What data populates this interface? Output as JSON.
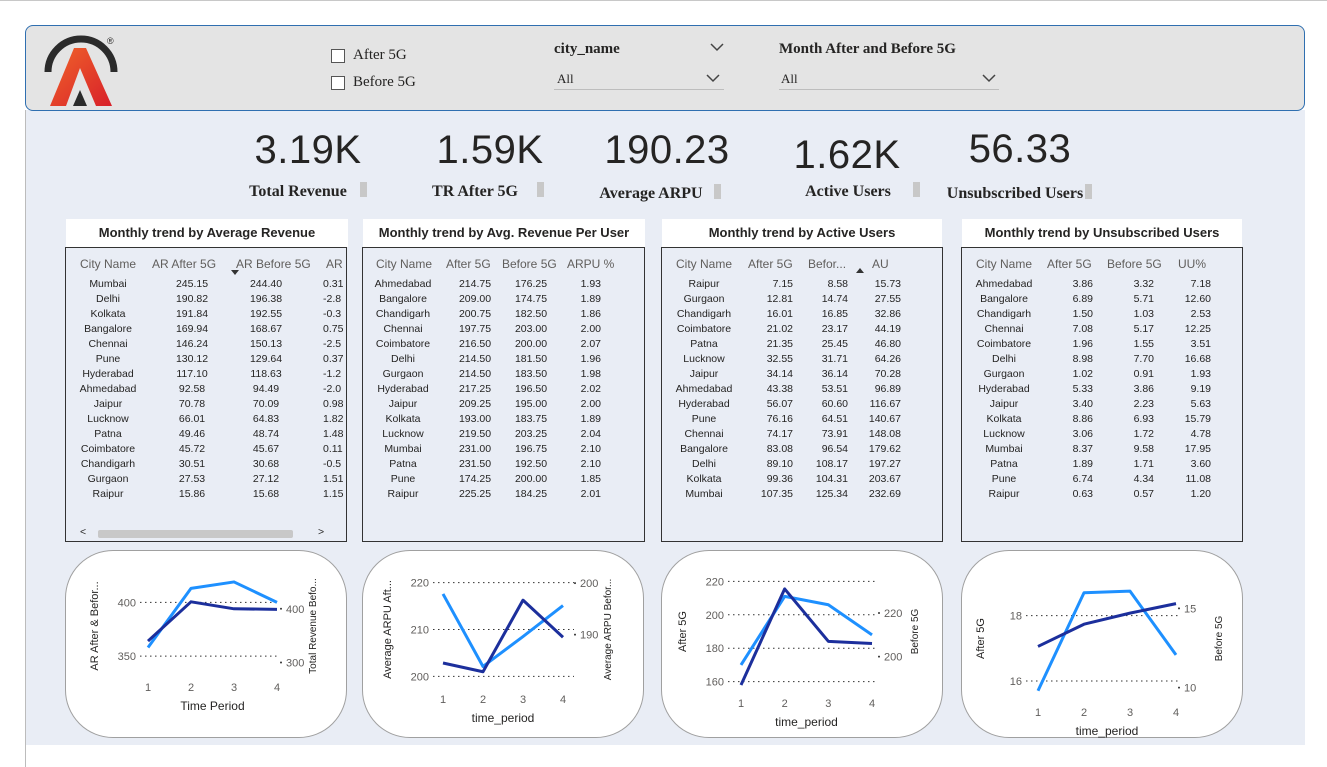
{
  "header": {
    "registered": "®",
    "checkboxes": [
      "After 5G",
      "Before 5G"
    ],
    "slicer_city": {
      "title": "city_name",
      "value": "All"
    },
    "slicer_month": {
      "title": "Month After and Before 5G",
      "value": "All"
    }
  },
  "kpis": [
    {
      "value": "3.19K",
      "label": "Total Revenue"
    },
    {
      "value": "1.59K",
      "label": "TR After 5G"
    },
    {
      "value": "190.23",
      "label": "Average ARPU"
    },
    {
      "value": "1.62K",
      "label": "Active Users"
    },
    {
      "value": "56.33",
      "label": "Unsubscribed Users"
    }
  ],
  "tables": [
    {
      "title": "Monthly trend by Average Revenue",
      "headers": [
        "City Name",
        "AR After 5G",
        "AR Before 5G",
        "AR"
      ],
      "rows": [
        [
          "Mumbai",
          "245.15",
          "244.40",
          "0.31"
        ],
        [
          "Delhi",
          "190.82",
          "196.38",
          "-2.8"
        ],
        [
          "Kolkata",
          "191.84",
          "192.55",
          "-0.3"
        ],
        [
          "Bangalore",
          "169.94",
          "168.67",
          "0.75"
        ],
        [
          "Chennai",
          "146.24",
          "150.13",
          "-2.5"
        ],
        [
          "Pune",
          "130.12",
          "129.64",
          "0.37"
        ],
        [
          "Hyderabad",
          "117.10",
          "118.63",
          "-1.2"
        ],
        [
          "Ahmedabad",
          "92.58",
          "94.49",
          "-2.0"
        ],
        [
          "Jaipur",
          "70.78",
          "70.09",
          "0.98"
        ],
        [
          "Lucknow",
          "66.01",
          "64.83",
          "1.82"
        ],
        [
          "Patna",
          "49.46",
          "48.74",
          "1.48"
        ],
        [
          "Coimbatore",
          "45.72",
          "45.67",
          "0.11"
        ],
        [
          "Chandigarh",
          "30.51",
          "30.68",
          "-0.5"
        ],
        [
          "Gurgaon",
          "27.53",
          "27.12",
          "1.51"
        ],
        [
          "Raipur",
          "15.86",
          "15.68",
          "1.15"
        ]
      ],
      "scroll_left": "<",
      "scroll_right": ">"
    },
    {
      "title": "Monthly trend by Avg. Revenue Per User",
      "headers": [
        "City Name",
        "After 5G",
        "Before 5G",
        "ARPU %"
      ],
      "rows": [
        [
          "Ahmedabad",
          "214.75",
          "176.25",
          "1.93"
        ],
        [
          "Bangalore",
          "209.00",
          "174.75",
          "1.89"
        ],
        [
          "Chandigarh",
          "200.75",
          "182.50",
          "1.86"
        ],
        [
          "Chennai",
          "197.75",
          "203.00",
          "2.00"
        ],
        [
          "Coimbatore",
          "216.50",
          "200.00",
          "2.07"
        ],
        [
          "Delhi",
          "214.50",
          "181.50",
          "1.96"
        ],
        [
          "Gurgaon",
          "214.50",
          "183.50",
          "1.98"
        ],
        [
          "Hyderabad",
          "217.25",
          "196.50",
          "2.02"
        ],
        [
          "Jaipur",
          "209.25",
          "195.00",
          "2.00"
        ],
        [
          "Kolkata",
          "193.00",
          "183.75",
          "1.89"
        ],
        [
          "Lucknow",
          "219.50",
          "203.25",
          "2.04"
        ],
        [
          "Mumbai",
          "231.00",
          "196.75",
          "2.10"
        ],
        [
          "Patna",
          "231.50",
          "192.50",
          "2.10"
        ],
        [
          "Pune",
          "174.25",
          "200.00",
          "1.85"
        ],
        [
          "Raipur",
          "225.25",
          "184.25",
          "2.01"
        ]
      ]
    },
    {
      "title": "Monthly trend by Active Users",
      "headers": [
        "City Name",
        "After 5G",
        "Befor...",
        "AU"
      ],
      "rows": [
        [
          "Raipur",
          "7.15",
          "8.58",
          "15.73"
        ],
        [
          "Gurgaon",
          "12.81",
          "14.74",
          "27.55"
        ],
        [
          "Chandigarh",
          "16.01",
          "16.85",
          "32.86"
        ],
        [
          "Coimbatore",
          "21.02",
          "23.17",
          "44.19"
        ],
        [
          "Patna",
          "21.35",
          "25.45",
          "46.80"
        ],
        [
          "Lucknow",
          "32.55",
          "31.71",
          "64.26"
        ],
        [
          "Jaipur",
          "34.14",
          "36.14",
          "70.28"
        ],
        [
          "Ahmedabad",
          "43.38",
          "53.51",
          "96.89"
        ],
        [
          "Hyderabad",
          "56.07",
          "60.60",
          "116.67"
        ],
        [
          "Pune",
          "76.16",
          "64.51",
          "140.67"
        ],
        [
          "Chennai",
          "74.17",
          "73.91",
          "148.08"
        ],
        [
          "Bangalore",
          "83.08",
          "96.54",
          "179.62"
        ],
        [
          "Delhi",
          "89.10",
          "108.17",
          "197.27"
        ],
        [
          "Kolkata",
          "99.36",
          "104.31",
          "203.67"
        ],
        [
          "Mumbai",
          "107.35",
          "125.34",
          "232.69"
        ]
      ]
    },
    {
      "title": "Monthly trend by Unsubscribed Users",
      "headers": [
        "City Name",
        "After 5G",
        "Before 5G",
        "UU%"
      ],
      "rows": [
        [
          "Ahmedabad",
          "3.86",
          "3.32",
          "7.18"
        ],
        [
          "Bangalore",
          "6.89",
          "5.71",
          "12.60"
        ],
        [
          "Chandigarh",
          "1.50",
          "1.03",
          "2.53"
        ],
        [
          "Chennai",
          "7.08",
          "5.17",
          "12.25"
        ],
        [
          "Coimbatore",
          "1.96",
          "1.55",
          "3.51"
        ],
        [
          "Delhi",
          "8.98",
          "7.70",
          "16.68"
        ],
        [
          "Gurgaon",
          "1.02",
          "0.91",
          "1.93"
        ],
        [
          "Hyderabad",
          "5.33",
          "3.86",
          "9.19"
        ],
        [
          "Jaipur",
          "3.40",
          "2.23",
          "5.63"
        ],
        [
          "Kolkata",
          "8.86",
          "6.93",
          "15.79"
        ],
        [
          "Lucknow",
          "3.06",
          "1.72",
          "4.78"
        ],
        [
          "Mumbai",
          "8.37",
          "9.58",
          "17.95"
        ],
        [
          "Patna",
          "1.89",
          "1.71",
          "3.60"
        ],
        [
          "Pune",
          "6.74",
          "4.34",
          "11.08"
        ],
        [
          "Raipur",
          "0.63",
          "0.57",
          "1.20"
        ]
      ]
    }
  ],
  "colors": {
    "light_series": "#1e90ff",
    "dark_series": "#1c2f9c",
    "grid": "#333333"
  },
  "chart_data": [
    {
      "type": "line",
      "xlabel": "Time Period",
      "ylabel": "AR After & Befor...",
      "y2label": "Total Revenue Befo...",
      "x": [
        1,
        2,
        3,
        4
      ],
      "ylim": [
        338,
        418
      ],
      "y2lim": [
        288,
        448
      ],
      "yticks": [
        350,
        400
      ],
      "y2ticks": [
        300,
        400
      ],
      "series": [
        {
          "axis": "left",
          "color": "#1e90ff",
          "values": [
            358,
            413,
            419,
            400
          ]
        },
        {
          "axis": "right",
          "color": "#1c2f9c",
          "values": [
            340,
            413,
            400,
            399
          ]
        }
      ]
    },
    {
      "type": "line",
      "xlabel": "time_period",
      "ylabel": "Average ARPU Aft...",
      "y2label": "Average ARPU Befor...",
      "x": [
        1,
        2,
        3,
        4
      ],
      "ylim": [
        199,
        221
      ],
      "y2lim": [
        181,
        201
      ],
      "yticks": [
        200,
        210,
        220
      ],
      "y2ticks": [
        190,
        200
      ],
      "series": [
        {
          "axis": "left",
          "color": "#1e90ff",
          "values": [
            217.6,
            202.1,
            208.5,
            215.1
          ]
        },
        {
          "axis": "right",
          "color": "#1c2f9c",
          "values": [
            184.5,
            182.8,
            196.7,
            189.5
          ]
        }
      ]
    },
    {
      "type": "line",
      "xlabel": "time_period",
      "ylabel": "After 5G",
      "y2label": "Before 5G",
      "x": [
        1,
        2,
        3,
        4
      ],
      "ylim": [
        158,
        222
      ],
      "y2lim": [
        187,
        236
      ],
      "yticks": [
        160,
        180,
        200,
        220
      ],
      "y2ticks": [
        200,
        220
      ],
      "series": [
        {
          "axis": "left",
          "color": "#1e90ff",
          "values": [
            170,
            211,
            206,
            188
          ]
        },
        {
          "axis": "right",
          "color": "#1c2f9c",
          "values": [
            187,
            231,
            207,
            206
          ]
        }
      ]
    },
    {
      "type": "line",
      "xlabel": "time_period",
      "ylabel": "After 5G",
      "y2label": "Before 5G",
      "x": [
        1,
        2,
        3,
        4
      ],
      "ylim": [
        15.6,
        19.0
      ],
      "y2lim": [
        9.6,
        16.6
      ],
      "yticks": [
        16,
        18
      ],
      "y2ticks": [
        10,
        15
      ],
      "series": [
        {
          "axis": "left",
          "color": "#1e90ff",
          "values": [
            15.7,
            18.7,
            18.75,
            16.8
          ]
        },
        {
          "axis": "right",
          "color": "#1c2f9c",
          "values": [
            12.6,
            14.0,
            14.7,
            15.3
          ]
        }
      ]
    }
  ]
}
